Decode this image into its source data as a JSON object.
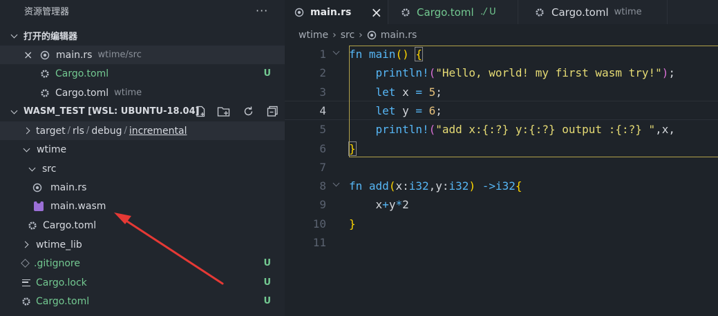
{
  "explorer": {
    "title": "资源管理器",
    "more": "···"
  },
  "open_editors": {
    "label": "打开的编辑器",
    "items": [
      {
        "name": "main.rs",
        "path": "wtime/src",
        "badge": ""
      },
      {
        "name": "Cargo.toml",
        "path": "",
        "badge": "U"
      },
      {
        "name": "Cargo.toml",
        "path": "wtime",
        "badge": ""
      }
    ]
  },
  "workspace": {
    "label": "WASM_TEST [WSL: UBUNTU-18.04]"
  },
  "tree": {
    "target_path": [
      "target",
      "rls",
      "debug",
      "incremental"
    ],
    "wtime": "wtime",
    "src": "src",
    "main_rs": "main.rs",
    "main_wasm": "main.wasm",
    "wtime_cargo": "Cargo.toml",
    "wtime_lib": "wtime_lib",
    "gitignore": "gitignore",
    "gitignore_dot": ".",
    "gitignore_badge": "U",
    "cargo_lock": "Cargo.lock",
    "cargo_lock_badge": "U",
    "cargo_toml": "Cargo.toml",
    "cargo_toml_badge": "U"
  },
  "tabs": [
    {
      "name": "main.rs",
      "close": "×"
    },
    {
      "name": "Cargo.toml",
      "path": "./",
      "badge": "U"
    },
    {
      "name": "Cargo.toml",
      "path": "wtime"
    }
  ],
  "breadcrumb": [
    "wtime",
    "src",
    "main.rs"
  ],
  "colors": {
    "accent_green": "#73c991",
    "arrow": "#e53935",
    "wasm_icon": "#9b6fd6"
  },
  "line_numbers": [
    "1",
    "2",
    "3",
    "4",
    "5",
    "6",
    "7",
    "8",
    "9",
    "10",
    "11"
  ]
}
